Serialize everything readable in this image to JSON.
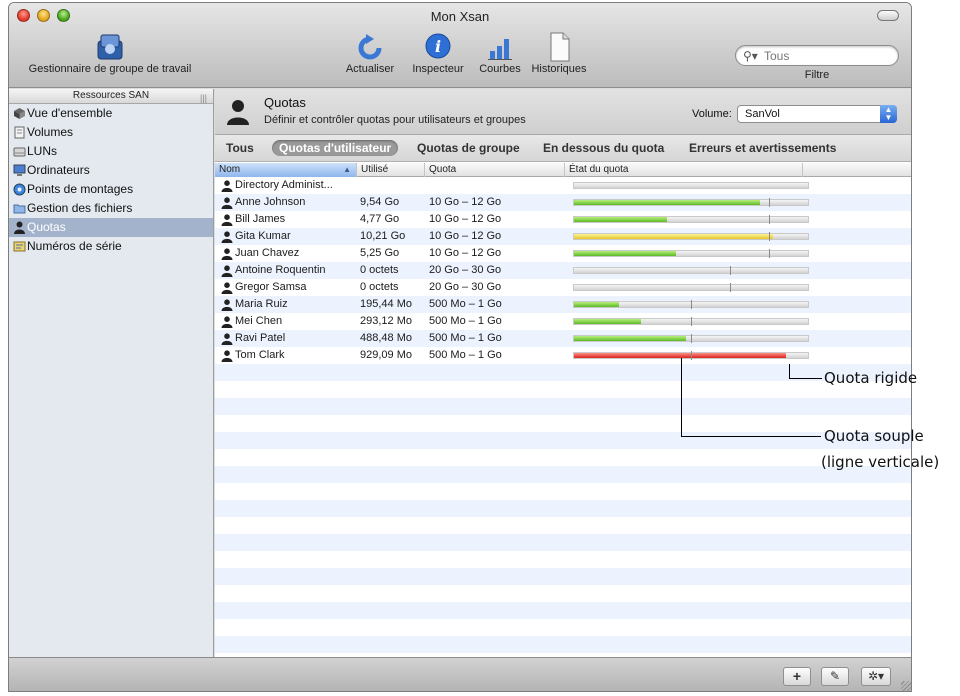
{
  "window": {
    "title": "Mon Xsan"
  },
  "toolbar": {
    "workgroup_label": "Gestionnaire de groupe de travail",
    "refresh_label": "Actualiser",
    "inspector_label": "Inspecteur",
    "charts_label": "Courbes",
    "logs_label": "Historiques",
    "search_placeholder": "Tous",
    "filter_label": "Filtre"
  },
  "sidebar": {
    "header": "Ressources SAN",
    "items": [
      {
        "label": "Vue d'ensemble",
        "icon": "overview-icon"
      },
      {
        "label": "Volumes",
        "icon": "volumes-icon"
      },
      {
        "label": "LUNs",
        "icon": "lun-icon"
      },
      {
        "label": "Ordinateurs",
        "icon": "computer-icon"
      },
      {
        "label": "Points de montages",
        "icon": "mount-points-icon"
      },
      {
        "label": "Gestion des fichiers",
        "icon": "folder-icon"
      },
      {
        "label": "Quotas",
        "icon": "person-icon",
        "selected": true
      },
      {
        "label": "Numéros de série",
        "icon": "serial-numbers-icon"
      }
    ]
  },
  "main": {
    "title": "Quotas",
    "description": "Définir et contrôler quotas pour utilisateurs et groupes",
    "volume_label": "Volume:",
    "volume_value": "SanVol",
    "filters": {
      "all": "Tous",
      "user": "Quotas d'utilisateur",
      "group": "Quotas de groupe",
      "below": "En dessous du quota",
      "errors": "Erreurs et avertissements"
    },
    "columns": {
      "name": "Nom",
      "used": "Utilisé",
      "quota": "Quota",
      "state": "État du quota"
    },
    "rows": [
      {
        "name": "Directory Administ...",
        "used": "",
        "quota": "",
        "fill": 0,
        "soft": null,
        "status": "none"
      },
      {
        "name": "Anne Johnson",
        "used": "9,54 Go",
        "quota": "10 Go – 12 Go",
        "fill": 0.795,
        "soft": 0.833,
        "status": "green"
      },
      {
        "name": "Bill James",
        "used": "4,77 Go",
        "quota": "10 Go – 12 Go",
        "fill": 0.398,
        "soft": 0.833,
        "status": "green"
      },
      {
        "name": "Gita Kumar",
        "used": "10,21 Go",
        "quota": "10 Go – 12 Go",
        "fill": 0.851,
        "soft": 0.833,
        "status": "yellow"
      },
      {
        "name": "Juan Chavez",
        "used": "5,25 Go",
        "quota": "10 Go – 12 Go",
        "fill": 0.438,
        "soft": 0.833,
        "status": "green"
      },
      {
        "name": "Antoine Roquentin",
        "used": "0 octets",
        "quota": "20 Go – 30 Go",
        "fill": 0,
        "soft": 0.667,
        "status": "green"
      },
      {
        "name": "Gregor Samsa",
        "used": "0 octets",
        "quota": "20 Go – 30 Go",
        "fill": 0,
        "soft": 0.667,
        "status": "green"
      },
      {
        "name": "Maria Ruiz",
        "used": "195,44 Mo",
        "quota": "500 Mo – 1 Go",
        "fill": 0.191,
        "soft": 0.5,
        "status": "green"
      },
      {
        "name": "Mei Chen",
        "used": "293,12 Mo",
        "quota": "500 Mo – 1 Go",
        "fill": 0.286,
        "soft": 0.5,
        "status": "green"
      },
      {
        "name": "Ravi Patel",
        "used": "488,48 Mo",
        "quota": "500 Mo – 1 Go",
        "fill": 0.477,
        "soft": 0.5,
        "status": "green"
      },
      {
        "name": "Tom Clark",
        "used": "929,09 Mo",
        "quota": "500 Mo – 1 Go",
        "fill": 0.907,
        "soft": 0.5,
        "status": "red"
      }
    ]
  },
  "callouts": {
    "hard_quota": "Quota rigide",
    "soft_quota_line1": "Quota souple",
    "soft_quota_line2": "(ligne verticale)"
  },
  "bottombar": {
    "add": "+",
    "edit": "✎",
    "action": "✲▾"
  },
  "colors": {
    "selection": "#a4b3cc",
    "green": "#5eb829",
    "yellow": "#e5c62a",
    "red": "#d9231b",
    "stripe": "#edf3fe"
  }
}
